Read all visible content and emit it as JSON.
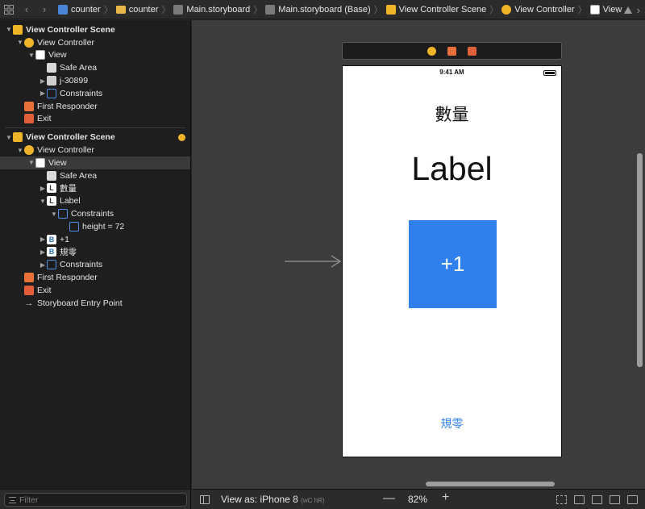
{
  "jumpbar": {
    "breadcrumbs": [
      {
        "label": "counter",
        "icon": "project-icon"
      },
      {
        "label": "counter",
        "icon": "folder-icon"
      },
      {
        "label": "Main.storyboard",
        "icon": "storyboard-icon"
      },
      {
        "label": "Main.storyboard (Base)",
        "icon": "storyboard-icon"
      },
      {
        "label": "View Controller Scene",
        "icon": "scene-icon"
      },
      {
        "label": "View Controller",
        "icon": "view-controller-icon"
      },
      {
        "label": "View",
        "icon": "view-icon"
      }
    ]
  },
  "outline": {
    "scene1": {
      "title": "View Controller Scene",
      "vc": "View Controller",
      "view": "View",
      "safe_area": "Safe Area",
      "image": "j-30899",
      "constraints": "Constraints",
      "first_responder": "First Responder",
      "exit": "Exit"
    },
    "scene2": {
      "title": "View Controller Scene",
      "vc": "View Controller",
      "view": "View",
      "safe_area": "Safe Area",
      "label1": "數量",
      "label2": "Label",
      "label2_constraints": "Constraints",
      "height_constraint": "height = 72",
      "button1": "+1",
      "button2": "規零",
      "constraints": "Constraints",
      "first_responder": "First Responder",
      "exit": "Exit",
      "entry_point": "Storyboard Entry Point"
    },
    "icon_letters": {
      "label": "L",
      "button": "B"
    }
  },
  "filter": {
    "placeholder": "Filter"
  },
  "device": {
    "time": "9:41 AM",
    "title_label": "數量",
    "count_label": "Label",
    "plus_button": "+1",
    "reset_button": "規零"
  },
  "bottombar": {
    "view_as": "View as: iPhone 8",
    "traits": "(wC hR)",
    "zoom": "82%",
    "zoom_out": "—",
    "zoom_in": "+"
  },
  "colors": {
    "accent": "#2f80ed",
    "scene": "#f0b429"
  }
}
